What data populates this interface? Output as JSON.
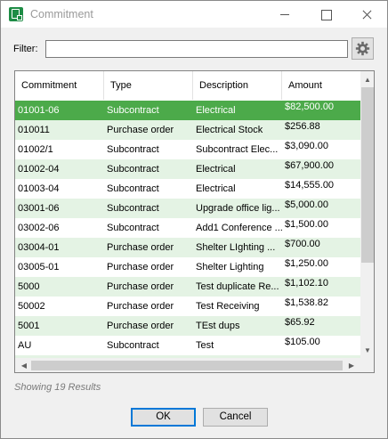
{
  "window": {
    "title": "Commitment"
  },
  "filter": {
    "label": "Filter:",
    "value": ""
  },
  "grid": {
    "columns": [
      "Commitment",
      "Type",
      "Description",
      "Amount"
    ],
    "rows": [
      {
        "commitment": "01001-06",
        "type": "Subcontract",
        "description": "Electrical",
        "amount": "$82,500.00"
      },
      {
        "commitment": "010011",
        "type": "Purchase order",
        "description": "Electrical Stock",
        "amount": "$256.88"
      },
      {
        "commitment": "01002/1",
        "type": "Subcontract",
        "description": "Subcontract Elec...",
        "amount": "$3,090.00"
      },
      {
        "commitment": "01002-04",
        "type": "Subcontract",
        "description": "Electrical",
        "amount": "$67,900.00"
      },
      {
        "commitment": "01003-04",
        "type": "Subcontract",
        "description": "Electrical",
        "amount": "$14,555.00"
      },
      {
        "commitment": "03001-06",
        "type": "Subcontract",
        "description": "Upgrade office lig...",
        "amount": "$5,000.00"
      },
      {
        "commitment": "03002-06",
        "type": "Subcontract",
        "description": "Add1 Conference ...",
        "amount": "$1,500.00"
      },
      {
        "commitment": "03004-01",
        "type": "Purchase order",
        "description": "Shelter LIghting ...",
        "amount": "$700.00"
      },
      {
        "commitment": "03005-01",
        "type": "Purchase order",
        "description": "Shelter Lighting",
        "amount": "$1,250.00"
      },
      {
        "commitment": "5000",
        "type": "Purchase order",
        "description": "Test duplicate Re...",
        "amount": "$1,102.10"
      },
      {
        "commitment": "50002",
        "type": "Purchase order",
        "description": "Test Receiving",
        "amount": "$1,538.82"
      },
      {
        "commitment": "5001",
        "type": "Purchase order",
        "description": "TEst dups",
        "amount": "$65.92"
      },
      {
        "commitment": "AU",
        "type": "Subcontract",
        "description": "Test",
        "amount": "$105.00"
      }
    ],
    "selected_index": 0
  },
  "status": {
    "results": "Showing 19 Results"
  },
  "buttons": {
    "ok": "OK",
    "cancel": "Cancel"
  },
  "colors": {
    "selected_row": "#4caa4a",
    "alt_row": "#e4f3e4",
    "accent": "#0078d7",
    "app_icon": "#1e8c45"
  },
  "icons": {
    "app": "commitment-app-icon",
    "settings": "gear-icon"
  }
}
